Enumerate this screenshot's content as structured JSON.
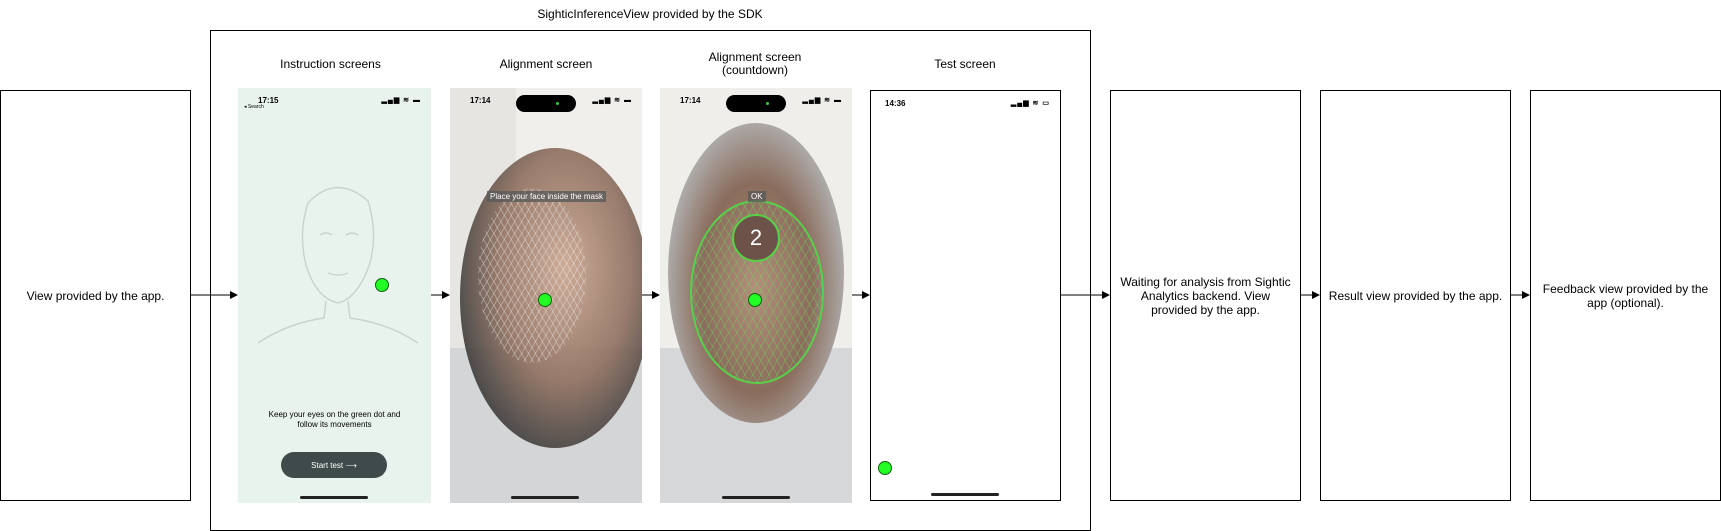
{
  "sdk_container": {
    "title": "SighticInferenceView provided by the SDK"
  },
  "app_view": {
    "text": "View provided by the app."
  },
  "screens": {
    "instruction": {
      "heading": "Instruction screens",
      "time": "17:15",
      "back_label": "◂ Search",
      "body_text": "Keep your eyes on the green dot and follow its movements",
      "start_button": "Start test ⟶"
    },
    "alignment": {
      "heading": "Alignment screen",
      "time": "17:14",
      "hint": "Place your face inside the mask"
    },
    "countdown": {
      "heading": "Alignment screen (countdown)",
      "time": "17:14",
      "hint": "OK",
      "count": "2"
    },
    "test": {
      "heading": "Test screen",
      "time": "14:36"
    }
  },
  "waiting_view": {
    "text": "Waiting for analysis from Sightic Analytics backend. View provided by the app."
  },
  "result_view": {
    "text": "Result view provided by the app."
  },
  "feedback_view": {
    "text": "Feedback view provided by the app (optional)."
  },
  "icons": {
    "status_icons": "signal-wifi-battery-icons",
    "arrow": "arrow-right-icon"
  },
  "colors": {
    "green_dot": "#22ff22",
    "instruction_bg": "#e9f3ee",
    "button_bg": "#3f4a4a"
  }
}
